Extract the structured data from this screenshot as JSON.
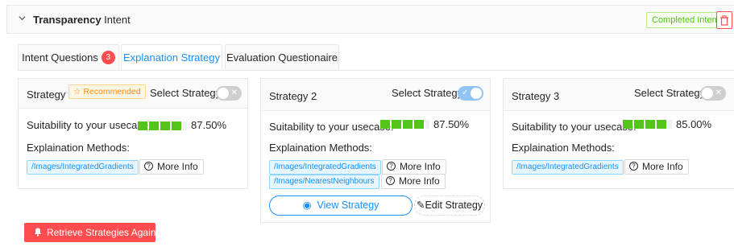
{
  "header": {
    "title_bold": "Transparency",
    "title_rest": " Intent",
    "status_badge": "Completed Intent"
  },
  "tabs": [
    {
      "label": "Intent Questions",
      "count": "3"
    },
    {
      "label": "Explanation Strategy"
    },
    {
      "label": "Evaluation Questionaire"
    }
  ],
  "active_tab": "Explanation Strategy",
  "colors": {
    "accent": "#1890ff",
    "danger": "#ff4d4f",
    "success": "#52c41a",
    "recommended": "#fa8c16"
  },
  "strategies": [
    {
      "title": "Strategy 1",
      "recommended": "Recommended",
      "select_label": "Select Strategy:",
      "selected": false,
      "suitability_label": "Suitability to your usecase:",
      "suitability_pct": "87.50%",
      "suitability_value": 0.875,
      "methods_label": "Explaination Methods:",
      "methods": [
        {
          "name": "/Images/IntegratedGradients",
          "info": "More Info"
        }
      ]
    },
    {
      "title": "Strategy 2",
      "select_label": "Select Strategy:",
      "selected": true,
      "suitability_label": "Suitability to your usecase:",
      "suitability_pct": "87.50%",
      "suitability_value": 0.875,
      "methods_label": "Explaination Methods:",
      "methods": [
        {
          "name": "/Images/IntegratedGradients",
          "info": "More Info"
        },
        {
          "name": "/Images/NearestNeighbours",
          "info": "More Info"
        }
      ],
      "view_label": "View Strategy",
      "edit_label": "Edit Strategy"
    },
    {
      "title": "Strategy 3",
      "select_label": "Select Strategy:",
      "selected": false,
      "suitability_label": "Suitability to your usecase:",
      "suitability_pct": "85.00%",
      "suitability_value": 0.85,
      "methods_label": "Explaination Methods:",
      "methods": [
        {
          "name": "/Images/IntegratedGradients",
          "info": "More Info"
        }
      ]
    }
  ],
  "retrieve_label": "Retrieve Strategies Again",
  "icons": {
    "collapse": "chevron-down-icon",
    "delete": "trash-icon",
    "recommended": "star-icon",
    "info": "question-circle-icon",
    "view": "eye-icon",
    "edit": "edit-icon",
    "retrieve": "bell-icon"
  }
}
